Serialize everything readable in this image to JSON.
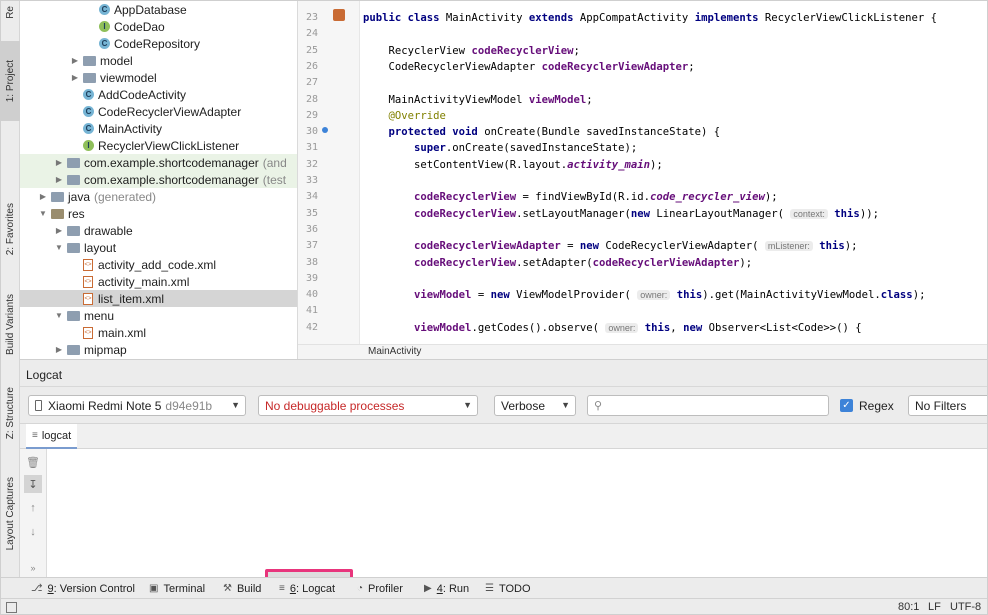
{
  "left_strip": {
    "tabs": [
      {
        "label": "Re",
        "icon": "resource-icon"
      },
      {
        "label": "1: Project",
        "icon": "folder-icon"
      },
      {
        "label": "2: Favorites",
        "icon": "star-icon"
      },
      {
        "label": "Build Variants",
        "icon": "build-variants-icon"
      },
      {
        "label": "Z: Structure",
        "icon": "structure-icon"
      },
      {
        "label": "Layout Captures",
        "icon": "capture-icon"
      }
    ]
  },
  "project_tree": {
    "items": [
      {
        "label": "AppDatabase",
        "kind": "class",
        "depth": 4
      },
      {
        "label": "CodeDao",
        "kind": "interface",
        "depth": 4
      },
      {
        "label": "CodeRepository",
        "kind": "class",
        "depth": 4
      },
      {
        "label": "model",
        "kind": "folder",
        "depth": 3,
        "collapsed": true
      },
      {
        "label": "viewmodel",
        "kind": "folder",
        "depth": 3,
        "collapsed": true
      },
      {
        "label": "AddCodeActivity",
        "kind": "class",
        "depth": 3
      },
      {
        "label": "CodeRecyclerViewAdapter",
        "kind": "class",
        "depth": 3
      },
      {
        "label": "MainActivity",
        "kind": "class",
        "depth": 3
      },
      {
        "label": "RecyclerViewClickListener",
        "kind": "interface",
        "depth": 3
      },
      {
        "label": "com.example.shortcodemanager",
        "suffix": "(and",
        "kind": "package",
        "depth": 2,
        "collapsed": true
      },
      {
        "label": "com.example.shortcodemanager",
        "suffix": "(test",
        "kind": "package",
        "depth": 2,
        "collapsed": true
      },
      {
        "label": "java",
        "suffix": "(generated)",
        "kind": "folder",
        "depth": 1,
        "collapsed": true
      },
      {
        "label": "res",
        "kind": "res-folder",
        "depth": 1,
        "expanded": true
      },
      {
        "label": "drawable",
        "kind": "folder",
        "depth": 2,
        "collapsed": true
      },
      {
        "label": "layout",
        "kind": "folder",
        "depth": 2,
        "expanded": true
      },
      {
        "label": "activity_add_code.xml",
        "kind": "xml",
        "depth": 3
      },
      {
        "label": "activity_main.xml",
        "kind": "xml",
        "depth": 3
      },
      {
        "label": "list_item.xml",
        "kind": "xml",
        "depth": 3,
        "selected": true
      },
      {
        "label": "menu",
        "kind": "folder",
        "depth": 2,
        "expanded": true
      },
      {
        "label": "main.xml",
        "kind": "xml",
        "depth": 3
      },
      {
        "label": "mipmap",
        "kind": "folder",
        "depth": 2,
        "collapsed": true
      }
    ]
  },
  "editor": {
    "breadcrumb": "MainActivity",
    "lines": [
      {
        "n": "23",
        "html": "<span class='kw'>public class</span> MainActivity <span class='kw'>extends</span> AppCompatActivity <span class='kw'>implements</span> RecyclerViewClickListener {"
      },
      {
        "n": "24",
        "html": ""
      },
      {
        "n": "25",
        "html": "    RecyclerView <span class='fld'>codeRecyclerView</span>;"
      },
      {
        "n": "26",
        "html": "    CodeRecyclerViewAdapter <span class='fld'>codeRecyclerViewAdapter</span>;"
      },
      {
        "n": "27",
        "html": ""
      },
      {
        "n": "28",
        "html": "    MainActivityViewModel <span class='fld'>viewModel</span>;"
      },
      {
        "n": "29",
        "html": "    <span class='ann'>@Override</span>"
      },
      {
        "n": "30",
        "html": "    <span class='kw'>protected void</span> onCreate(Bundle savedInstanceState) {"
      },
      {
        "n": "31",
        "html": "        <span class='kw'>super</span>.onCreate(savedInstanceState);"
      },
      {
        "n": "32",
        "html": "        setContentView(R.layout.<span class='fld it'>activity_main</span>);"
      },
      {
        "n": "33",
        "html": ""
      },
      {
        "n": "34",
        "html": "        <span class='fld'>codeRecyclerView</span> = findViewById(R.id.<span class='fld it'>code_recycler_view</span>);"
      },
      {
        "n": "35",
        "html": "        <span class='fld'>codeRecyclerView</span>.setLayoutManager(<span class='kw'>new</span> LinearLayoutManager( <span class='hint'>context:</span> <span class='kw'>this</span>));"
      },
      {
        "n": "36",
        "html": ""
      },
      {
        "n": "37",
        "html": "        <span class='fld'>codeRecyclerViewAdapter</span> = <span class='kw'>new</span> CodeRecyclerViewAdapter( <span class='hint'>mListener:</span> <span class='kw'>this</span>);"
      },
      {
        "n": "38",
        "html": "        <span class='fld'>codeRecyclerView</span>.setAdapter(<span class='fld'>codeRecyclerViewAdapter</span>);"
      },
      {
        "n": "39",
        "html": ""
      },
      {
        "n": "40",
        "html": "        <span class='fld'>viewModel</span> = <span class='kw'>new</span> ViewModelProvider( <span class='hint'>owner:</span> <span class='kw'>this</span>).get(MainActivityViewModel.<span class='kw'>class</span>);"
      },
      {
        "n": "41",
        "html": ""
      },
      {
        "n": "42",
        "html": "        <span class='fld'>viewModel</span>.getCodes().observe( <span class='hint'>owner:</span> <span class='kw'>this</span>, <span class='kw'>new</span> Observer&lt;List&lt;Code&gt;&gt;() {"
      }
    ]
  },
  "logcat": {
    "title": "Logcat",
    "device": "Xiaomi Redmi Note 5",
    "device_id": "d94e91b",
    "process": "No debuggable processes",
    "level": "Verbose",
    "search_placeholder": "",
    "regex_label": "Regex",
    "regex_checked": true,
    "filter": "No Filters",
    "tab_label": "logcat"
  },
  "bottom_tabs": [
    {
      "mnemonic": "9",
      "label": ": Version Control",
      "icon": "version-control-icon"
    },
    {
      "mnemonic": "",
      "label": "Terminal",
      "icon": "terminal-icon"
    },
    {
      "mnemonic": "",
      "label": "Build",
      "icon": "hammer-icon"
    },
    {
      "mnemonic": "6",
      "label": ": Logcat",
      "icon": "logcat-icon",
      "highlighted": true
    },
    {
      "mnemonic": "",
      "label": "Profiler",
      "icon": "profiler-icon"
    },
    {
      "mnemonic": "4",
      "label": ": Run",
      "icon": "run-icon"
    },
    {
      "mnemonic": "",
      "label": "TODO",
      "icon": "todo-icon"
    }
  ],
  "status": {
    "position": "80:1",
    "line_sep": "LF",
    "encoding": "UTF-8"
  },
  "colors": {
    "highlight": "#e8357c",
    "keyword": "#000080",
    "field": "#660e7a",
    "error_text": "#c62828"
  }
}
